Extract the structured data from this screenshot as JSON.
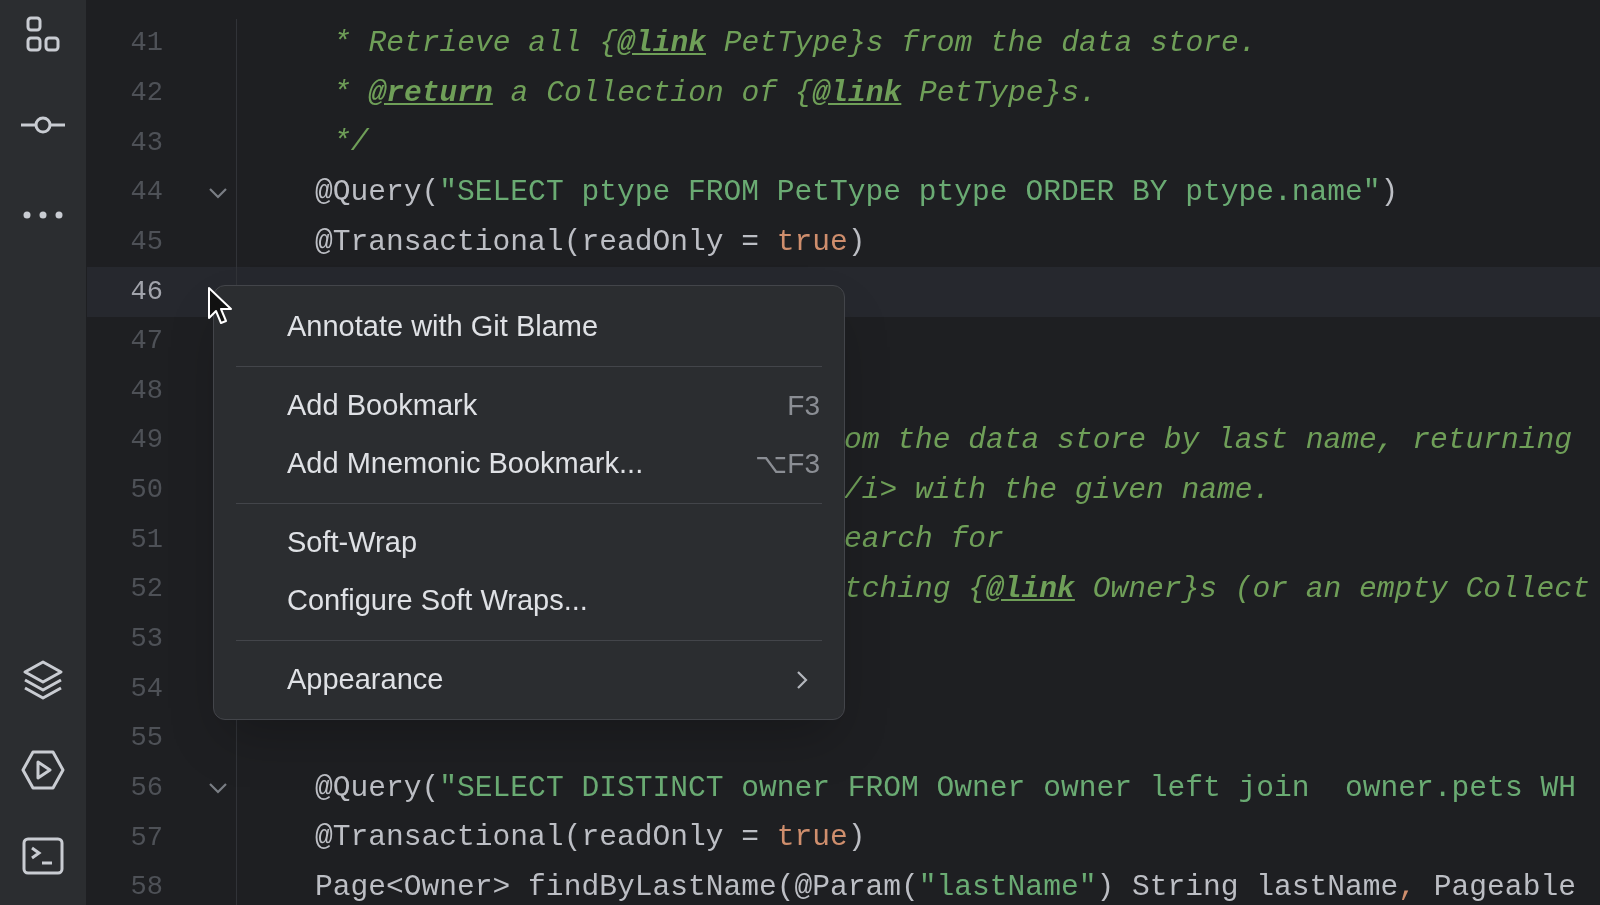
{
  "editor": {
    "lines": [
      {
        "number": "41",
        "current": false,
        "fold": false,
        "kind": "doc",
        "tokens": [
          {
            "kind": "comment",
            "text": "* Retrieve all {"
          },
          {
            "kind": "tag",
            "text": "@link"
          },
          {
            "kind": "comment",
            "text": " PetType}s from the data store."
          }
        ]
      },
      {
        "number": "42",
        "current": false,
        "fold": false,
        "kind": "doc",
        "tokens": [
          {
            "kind": "comment",
            "text": "* "
          },
          {
            "kind": "tag",
            "text": "@return"
          },
          {
            "kind": "comment",
            "text": " a Collection of {"
          },
          {
            "kind": "tag",
            "text": "@link"
          },
          {
            "kind": "comment",
            "text": " PetType}s."
          }
        ]
      },
      {
        "number": "43",
        "current": false,
        "fold": false,
        "kind": "doc",
        "tokens": [
          {
            "kind": "comment",
            "text": "*/"
          }
        ]
      },
      {
        "number": "44",
        "current": false,
        "fold": true,
        "kind": "code",
        "tokens": [
          {
            "kind": "plain",
            "text": "@Query("
          },
          {
            "kind": "string",
            "text": "\"SELECT ptype FROM PetType ptype ORDER BY ptype.name\""
          },
          {
            "kind": "plain",
            "text": ")"
          }
        ]
      },
      {
        "number": "45",
        "current": false,
        "fold": false,
        "kind": "code",
        "tokens": [
          {
            "kind": "plain",
            "text": "@Transactional(readOnly = "
          },
          {
            "kind": "keyword",
            "text": "true"
          },
          {
            "kind": "plain",
            "text": ")"
          }
        ]
      },
      {
        "number": "46",
        "current": true,
        "fold": false
      },
      {
        "number": "47",
        "current": false,
        "fold": false
      },
      {
        "number": "48",
        "current": false,
        "fold": false
      },
      {
        "number": "49",
        "current": false,
        "fold": false,
        "kind": "partial",
        "tokens": [
          {
            "kind": "comment",
            "text": "om the data store by last name, returning"
          }
        ]
      },
      {
        "number": "50",
        "current": false,
        "fold": false,
        "kind": "partial",
        "tokens": [
          {
            "kind": "comment",
            "text": "/i> with the given name."
          }
        ]
      },
      {
        "number": "51",
        "current": false,
        "fold": false,
        "kind": "partial",
        "tokens": [
          {
            "kind": "comment",
            "text": "earch for"
          }
        ]
      },
      {
        "number": "52",
        "current": false,
        "fold": false,
        "kind": "partial",
        "tokens": [
          {
            "kind": "comment",
            "text": "tching {"
          },
          {
            "kind": "tag",
            "text": "@link"
          },
          {
            "kind": "comment",
            "text": " Owner}s (or an empty Collect"
          }
        ]
      },
      {
        "number": "53",
        "current": false,
        "fold": false
      },
      {
        "number": "54",
        "current": false,
        "fold": false
      },
      {
        "number": "55",
        "current": false,
        "fold": false
      },
      {
        "number": "56",
        "current": false,
        "fold": true,
        "kind": "code",
        "tokens": [
          {
            "kind": "plain",
            "text": "@Query("
          },
          {
            "kind": "string",
            "text": "\"SELECT DISTINCT owner FROM Owner owner left join  owner.pets WH"
          }
        ]
      },
      {
        "number": "57",
        "current": false,
        "fold": false,
        "kind": "code",
        "tokens": [
          {
            "kind": "plain",
            "text": "@Transactional(readOnly = "
          },
          {
            "kind": "keyword",
            "text": "true"
          },
          {
            "kind": "plain",
            "text": ")"
          }
        ]
      },
      {
        "number": "58",
        "current": false,
        "fold": false,
        "kind": "code",
        "tokens": [
          {
            "kind": "plain",
            "text": "Page<Owner> findByLastName(@Param("
          },
          {
            "kind": "string",
            "text": "\"lastName\""
          },
          {
            "kind": "plain",
            "text": ") String lastName"
          },
          {
            "kind": "keyword",
            "text": ","
          },
          {
            "kind": "plain",
            "text": " Pageable"
          }
        ]
      }
    ]
  },
  "context_menu": {
    "groups": [
      {
        "items": [
          {
            "label": "Annotate with Git Blame",
            "submenu": false
          }
        ]
      },
      {
        "items": [
          {
            "label": "Add Bookmark",
            "shortcut": "F3",
            "submenu": false
          },
          {
            "label": "Add Mnemonic Bookmark...",
            "shortcut": "⌥F3",
            "submenu": false
          }
        ]
      },
      {
        "items": [
          {
            "label": "Soft-Wrap",
            "submenu": false
          },
          {
            "label": "Configure Soft Wraps...",
            "submenu": false
          }
        ]
      },
      {
        "items": [
          {
            "label": "Appearance",
            "submenu": true
          }
        ]
      }
    ]
  }
}
